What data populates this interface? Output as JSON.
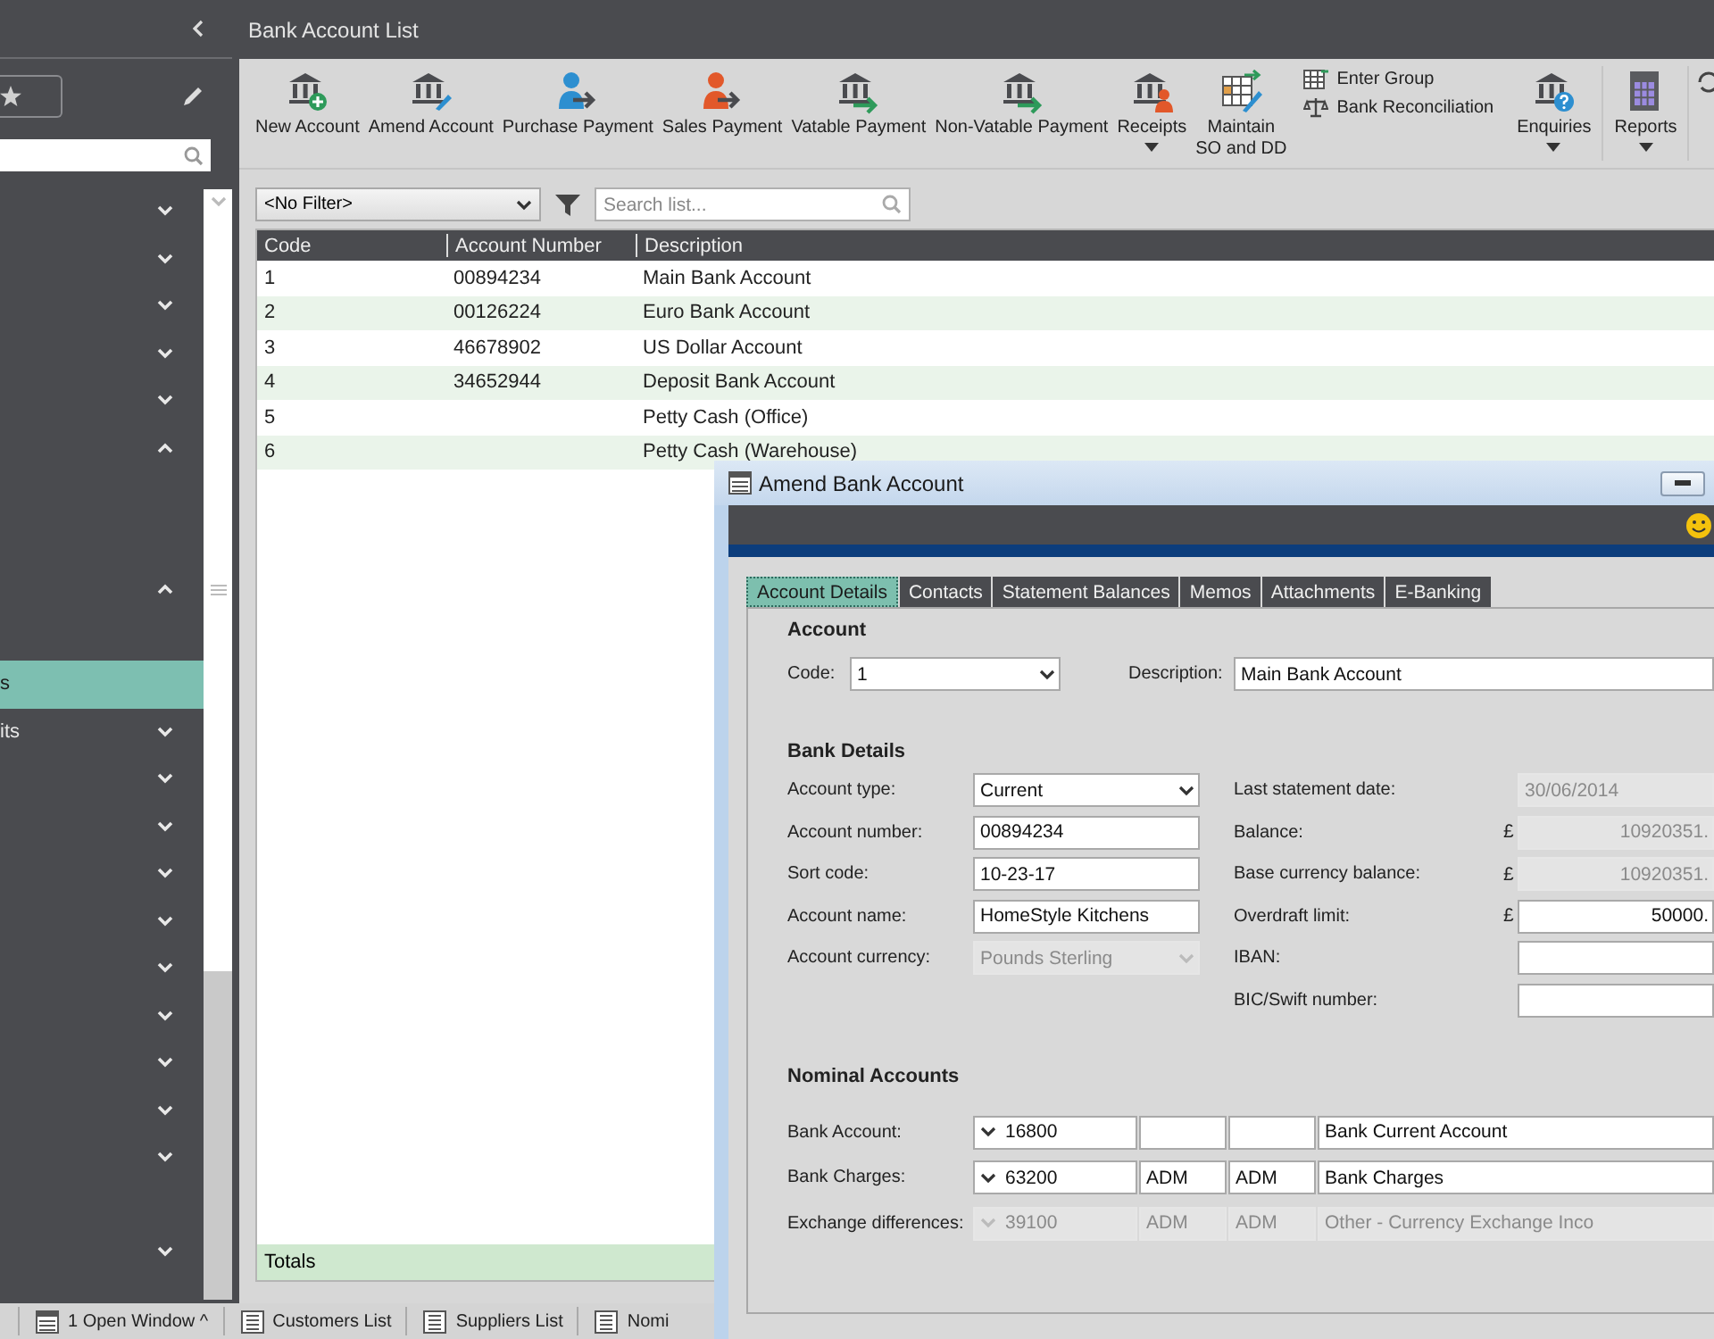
{
  "sidebar": {
    "rows": [
      {
        "kind": "group",
        "expanded": false
      },
      {
        "kind": "group",
        "expanded": false
      },
      {
        "kind": "group",
        "expanded": false
      },
      {
        "kind": "group",
        "expanded": false
      },
      {
        "kind": "group",
        "expanded": false
      },
      {
        "kind": "group",
        "expanded": true
      },
      {
        "kind": "empty"
      },
      {
        "kind": "empty"
      },
      {
        "kind": "group",
        "expanded": true
      },
      {
        "kind": "empty"
      },
      {
        "kind": "child",
        "label": "s",
        "selected": true
      },
      {
        "kind": "group",
        "label": "its",
        "expanded": false
      },
      {
        "kind": "group",
        "expanded": false
      },
      {
        "kind": "group",
        "expanded": false
      },
      {
        "kind": "group",
        "expanded": false
      },
      {
        "kind": "group",
        "expanded": false
      },
      {
        "kind": "group",
        "expanded": false
      },
      {
        "kind": "group",
        "expanded": false
      },
      {
        "kind": "group",
        "expanded": false
      },
      {
        "kind": "group",
        "expanded": false
      },
      {
        "kind": "group",
        "expanded": false
      },
      {
        "kind": "empty"
      },
      {
        "kind": "group",
        "expanded": false
      }
    ]
  },
  "list_window": {
    "title": "Bank Account List",
    "toolbar": {
      "buttons": [
        {
          "label": "New Account",
          "kind": "bank-plus",
          "dropdown": false
        },
        {
          "label": "Amend Account",
          "kind": "bank-edit",
          "dropdown": false
        },
        {
          "label": "Purchase Payment",
          "kind": "person-blue",
          "dropdown": false
        },
        {
          "label": "Sales Payment",
          "kind": "person-orange",
          "dropdown": false
        },
        {
          "label": "Vatable Payment",
          "kind": "bank-arrow",
          "dropdown": false
        },
        {
          "label": "Non-Vatable Payment",
          "kind": "bank-arrow",
          "dropdown": false
        },
        {
          "label": "Receipts",
          "kind": "bank-person",
          "dropdown": true
        },
        {
          "label": "Maintain\nSO and DD",
          "kind": "grid-edit",
          "dropdown": false
        }
      ],
      "small_buttons": [
        {
          "label": "Enter Group",
          "kind": "grid"
        },
        {
          "label": "Bank Reconciliation",
          "kind": "scales"
        }
      ],
      "end_buttons": [
        {
          "label": "Enquiries",
          "kind": "bank-question",
          "dropdown": true
        },
        {
          "label": "Reports",
          "kind": "report",
          "dropdown": true
        }
      ]
    },
    "filter": {
      "value": "<No Filter>"
    },
    "search": {
      "placeholder": "Search list..."
    },
    "table": {
      "columns": [
        "Code",
        "Account Number",
        "Description"
      ],
      "rows": [
        [
          "1",
          "00894234",
          "Main Bank Account"
        ],
        [
          "2",
          "00126224",
          "Euro Bank Account"
        ],
        [
          "3",
          "46678902",
          "US Dollar Account"
        ],
        [
          "4",
          "34652944",
          "Deposit Bank Account"
        ],
        [
          "5",
          "",
          "Petty Cash (Office)"
        ],
        [
          "6",
          "",
          "Petty Cash (Warehouse)"
        ]
      ]
    },
    "totals_label": "Totals"
  },
  "dialog": {
    "title": "Amend Bank Account",
    "tabs": [
      {
        "label": "Account Details",
        "selected": true
      },
      {
        "label": "Contacts",
        "selected": false
      },
      {
        "label": "Statement Balances",
        "selected": false
      },
      {
        "label": "Memos",
        "selected": false
      },
      {
        "label": "Attachments",
        "selected": false
      },
      {
        "label": "E-Banking",
        "selected": false
      }
    ],
    "account_heading": "Account",
    "code": {
      "label": "Code:",
      "value": "1"
    },
    "description": {
      "label": "Description:",
      "value": "Main Bank Account"
    },
    "bank_heading": "Bank Details",
    "left_fields": [
      {
        "label": "Account type:",
        "value": "Current",
        "kind": "select",
        "disabled": false
      },
      {
        "label": "Account number:",
        "value": "00894234",
        "kind": "text",
        "disabled": false
      },
      {
        "label": "Sort code:",
        "value": "10-23-17",
        "kind": "text",
        "disabled": false
      },
      {
        "label": "Account name:",
        "value": "HomeStyle Kitchens",
        "kind": "text",
        "disabled": false
      },
      {
        "label": "Account currency:",
        "value": "Pounds Sterling",
        "kind": "select",
        "disabled": true
      }
    ],
    "right_fields": [
      {
        "label": "Last statement date:",
        "value": "30/06/2014",
        "disabled": true
      },
      {
        "label": "Balance:",
        "currency": "£",
        "value": "10920351.",
        "disabled": true
      },
      {
        "label": "Base currency balance:",
        "currency": "£",
        "value": "10920351.",
        "disabled": true
      },
      {
        "label": "Overdraft limit:",
        "currency": "£",
        "value": "50000.",
        "disabled": false
      },
      {
        "label": "IBAN:",
        "disabled": false
      },
      {
        "label": "BIC/Swift number:",
        "disabled": false
      }
    ],
    "nominal_heading": "Nominal Accounts",
    "nominal_rows": [
      {
        "label": "Bank Account:",
        "code": "16800",
        "name": "Bank Current Account",
        "disabled": false
      },
      {
        "label": "Bank Charges:",
        "code": "63200",
        "cost_centre": "ADM",
        "department": "ADM",
        "name": "Bank Charges",
        "disabled": false
      },
      {
        "label": "Exchange differences:",
        "code": "39100",
        "cost_centre": "ADM",
        "department": "ADM",
        "name": "Other - Currency Exchange Inco",
        "disabled": true
      }
    ]
  },
  "taskbar": [
    {
      "label": "1 Open Window ^",
      "kind": "window"
    },
    {
      "label": "Customers List",
      "kind": "list"
    },
    {
      "label": "Suppliers List",
      "kind": "list"
    },
    {
      "label": "Nomi",
      "kind": "list"
    }
  ]
}
